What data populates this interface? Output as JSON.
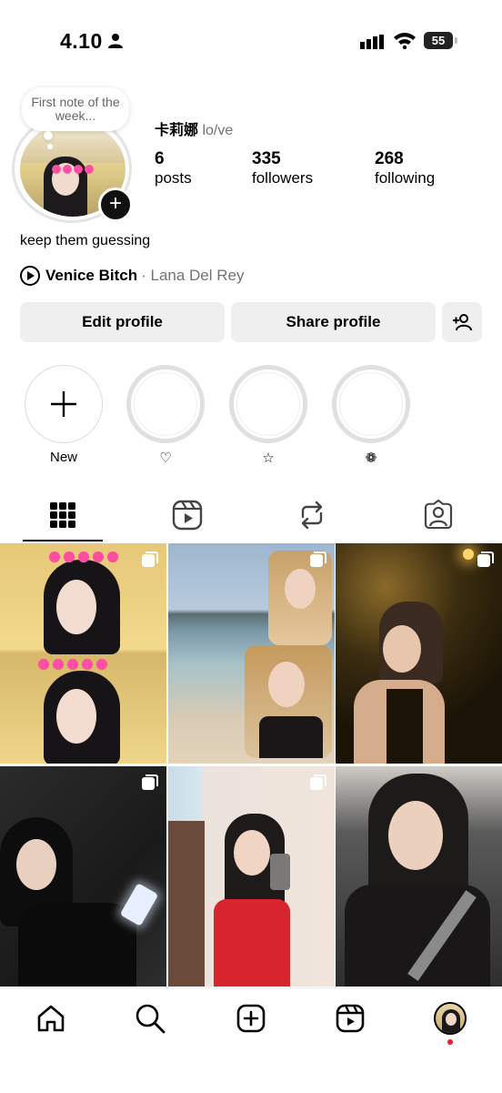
{
  "status": {
    "time": "4.10",
    "battery": "55"
  },
  "profile": {
    "note": "First note of the week...",
    "name": "卡莉娜",
    "pronouns": "lo/ve",
    "stats": [
      {
        "value": "6",
        "label": "posts"
      },
      {
        "value": "335",
        "label": "followers"
      },
      {
        "value": "268",
        "label": "following"
      }
    ],
    "bio": "keep them guessing",
    "music": {
      "title": "Venice Bitch",
      "artist": "· Lana Del Rey"
    }
  },
  "buttons": {
    "edit": "Edit profile",
    "share": "Share profile"
  },
  "highlights": [
    {
      "label": "New"
    },
    {
      "label": "♡"
    },
    {
      "label": "☆"
    },
    {
      "label": "❁"
    }
  ],
  "tabs": [
    "grid-icon",
    "reels-icon",
    "repost-icon",
    "tagged-icon"
  ],
  "colors": {
    "accent_dot": "#ed1c24"
  },
  "nav": [
    "home-icon",
    "search-icon",
    "create-icon",
    "reels-icon",
    "profile-avatar"
  ]
}
